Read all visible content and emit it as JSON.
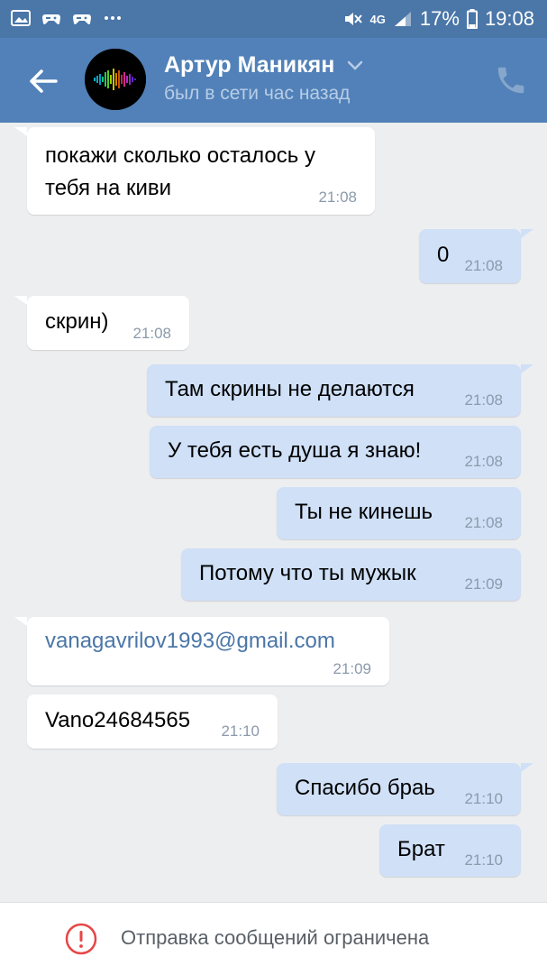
{
  "status_bar": {
    "icons_left": [
      "image-icon",
      "gamepad-icon",
      "gamepad-icon",
      "more-dots-icon"
    ],
    "network": "4G",
    "battery": "17%",
    "time": "19:08"
  },
  "header": {
    "name": "Артур Маникян",
    "status": "был в сети час назад"
  },
  "messages": [
    {
      "side": "in",
      "lines": [
        "покажи сколько осталось у",
        "тебя на киви"
      ],
      "time": "21:08"
    },
    {
      "side": "out",
      "text": "0",
      "time": "21:08"
    },
    {
      "side": "in",
      "text": "скрин)",
      "time": "21:08"
    },
    {
      "side": "out",
      "text": "Там скрины не делаются",
      "time": "21:08"
    },
    {
      "side": "out",
      "text": "У тебя есть душа я знаю!",
      "time": "21:08"
    },
    {
      "side": "out",
      "text": "Ты не кинешь",
      "time": "21:08"
    },
    {
      "side": "out",
      "text": "Потому что ты мужык",
      "time": "21:09"
    },
    {
      "side": "in",
      "text": "vanagavrilov1993@gmail.com",
      "time": "21:09",
      "is_link": true
    },
    {
      "side": "in",
      "text": "Vano24684565",
      "time": "21:10"
    },
    {
      "side": "out",
      "text": "Спасибо браь",
      "time": "21:10"
    },
    {
      "side": "out",
      "text": "Брат",
      "time": "21:10"
    }
  ],
  "footer": {
    "text": "Отправка сообщений ограничена"
  },
  "colors": {
    "header_bg": "#5181b8",
    "status_bg": "#4a76a8",
    "chat_bg": "#edeef0",
    "outgoing_bubble": "#cfe0f7",
    "incoming_bubble": "#ffffff",
    "link": "#4a76a8",
    "warning_red": "#e64646"
  }
}
